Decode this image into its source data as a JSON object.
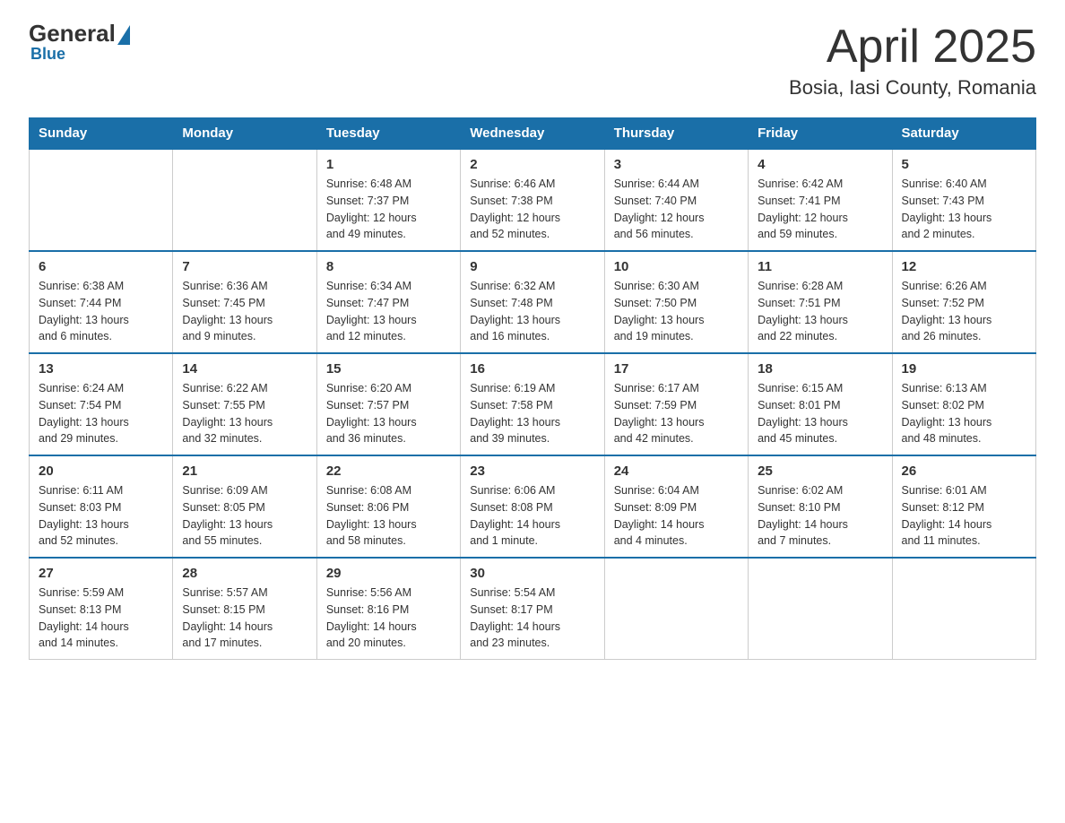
{
  "header": {
    "logo_general": "General",
    "logo_blue": "Blue",
    "month_title": "April 2025",
    "location": "Bosia, Iasi County, Romania"
  },
  "days_of_week": [
    "Sunday",
    "Monday",
    "Tuesday",
    "Wednesday",
    "Thursday",
    "Friday",
    "Saturday"
  ],
  "weeks": [
    [
      {
        "day": "",
        "info": ""
      },
      {
        "day": "",
        "info": ""
      },
      {
        "day": "1",
        "info": "Sunrise: 6:48 AM\nSunset: 7:37 PM\nDaylight: 12 hours\nand 49 minutes."
      },
      {
        "day": "2",
        "info": "Sunrise: 6:46 AM\nSunset: 7:38 PM\nDaylight: 12 hours\nand 52 minutes."
      },
      {
        "day": "3",
        "info": "Sunrise: 6:44 AM\nSunset: 7:40 PM\nDaylight: 12 hours\nand 56 minutes."
      },
      {
        "day": "4",
        "info": "Sunrise: 6:42 AM\nSunset: 7:41 PM\nDaylight: 12 hours\nand 59 minutes."
      },
      {
        "day": "5",
        "info": "Sunrise: 6:40 AM\nSunset: 7:43 PM\nDaylight: 13 hours\nand 2 minutes."
      }
    ],
    [
      {
        "day": "6",
        "info": "Sunrise: 6:38 AM\nSunset: 7:44 PM\nDaylight: 13 hours\nand 6 minutes."
      },
      {
        "day": "7",
        "info": "Sunrise: 6:36 AM\nSunset: 7:45 PM\nDaylight: 13 hours\nand 9 minutes."
      },
      {
        "day": "8",
        "info": "Sunrise: 6:34 AM\nSunset: 7:47 PM\nDaylight: 13 hours\nand 12 minutes."
      },
      {
        "day": "9",
        "info": "Sunrise: 6:32 AM\nSunset: 7:48 PM\nDaylight: 13 hours\nand 16 minutes."
      },
      {
        "day": "10",
        "info": "Sunrise: 6:30 AM\nSunset: 7:50 PM\nDaylight: 13 hours\nand 19 minutes."
      },
      {
        "day": "11",
        "info": "Sunrise: 6:28 AM\nSunset: 7:51 PM\nDaylight: 13 hours\nand 22 minutes."
      },
      {
        "day": "12",
        "info": "Sunrise: 6:26 AM\nSunset: 7:52 PM\nDaylight: 13 hours\nand 26 minutes."
      }
    ],
    [
      {
        "day": "13",
        "info": "Sunrise: 6:24 AM\nSunset: 7:54 PM\nDaylight: 13 hours\nand 29 minutes."
      },
      {
        "day": "14",
        "info": "Sunrise: 6:22 AM\nSunset: 7:55 PM\nDaylight: 13 hours\nand 32 minutes."
      },
      {
        "day": "15",
        "info": "Sunrise: 6:20 AM\nSunset: 7:57 PM\nDaylight: 13 hours\nand 36 minutes."
      },
      {
        "day": "16",
        "info": "Sunrise: 6:19 AM\nSunset: 7:58 PM\nDaylight: 13 hours\nand 39 minutes."
      },
      {
        "day": "17",
        "info": "Sunrise: 6:17 AM\nSunset: 7:59 PM\nDaylight: 13 hours\nand 42 minutes."
      },
      {
        "day": "18",
        "info": "Sunrise: 6:15 AM\nSunset: 8:01 PM\nDaylight: 13 hours\nand 45 minutes."
      },
      {
        "day": "19",
        "info": "Sunrise: 6:13 AM\nSunset: 8:02 PM\nDaylight: 13 hours\nand 48 minutes."
      }
    ],
    [
      {
        "day": "20",
        "info": "Sunrise: 6:11 AM\nSunset: 8:03 PM\nDaylight: 13 hours\nand 52 minutes."
      },
      {
        "day": "21",
        "info": "Sunrise: 6:09 AM\nSunset: 8:05 PM\nDaylight: 13 hours\nand 55 minutes."
      },
      {
        "day": "22",
        "info": "Sunrise: 6:08 AM\nSunset: 8:06 PM\nDaylight: 13 hours\nand 58 minutes."
      },
      {
        "day": "23",
        "info": "Sunrise: 6:06 AM\nSunset: 8:08 PM\nDaylight: 14 hours\nand 1 minute."
      },
      {
        "day": "24",
        "info": "Sunrise: 6:04 AM\nSunset: 8:09 PM\nDaylight: 14 hours\nand 4 minutes."
      },
      {
        "day": "25",
        "info": "Sunrise: 6:02 AM\nSunset: 8:10 PM\nDaylight: 14 hours\nand 7 minutes."
      },
      {
        "day": "26",
        "info": "Sunrise: 6:01 AM\nSunset: 8:12 PM\nDaylight: 14 hours\nand 11 minutes."
      }
    ],
    [
      {
        "day": "27",
        "info": "Sunrise: 5:59 AM\nSunset: 8:13 PM\nDaylight: 14 hours\nand 14 minutes."
      },
      {
        "day": "28",
        "info": "Sunrise: 5:57 AM\nSunset: 8:15 PM\nDaylight: 14 hours\nand 17 minutes."
      },
      {
        "day": "29",
        "info": "Sunrise: 5:56 AM\nSunset: 8:16 PM\nDaylight: 14 hours\nand 20 minutes."
      },
      {
        "day": "30",
        "info": "Sunrise: 5:54 AM\nSunset: 8:17 PM\nDaylight: 14 hours\nand 23 minutes."
      },
      {
        "day": "",
        "info": ""
      },
      {
        "day": "",
        "info": ""
      },
      {
        "day": "",
        "info": ""
      }
    ]
  ]
}
